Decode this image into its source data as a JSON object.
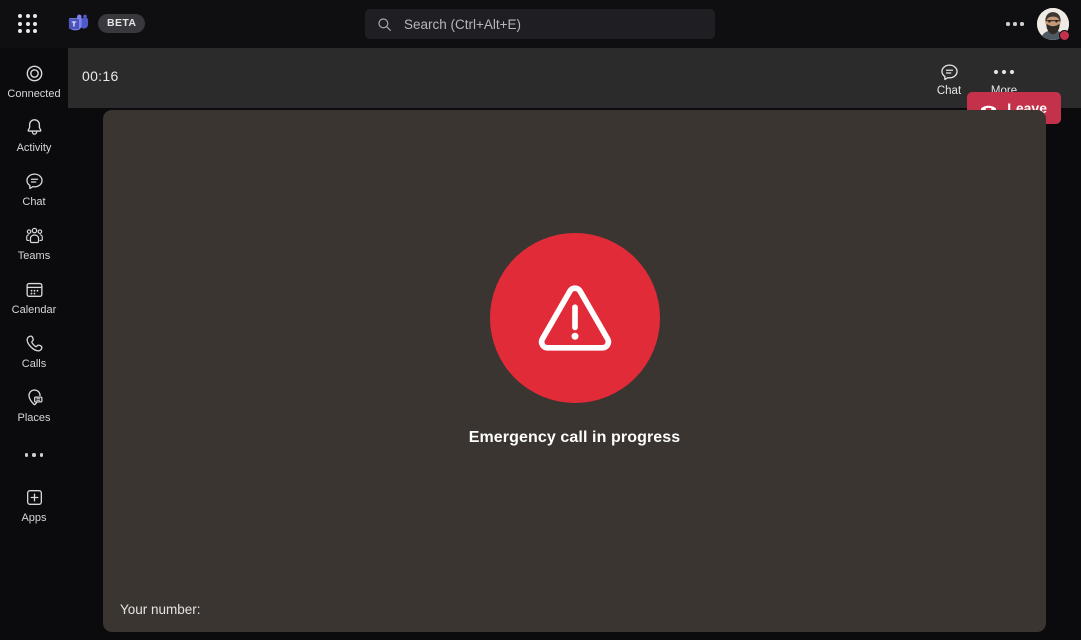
{
  "titlebar": {
    "app_launcher_icon": "waffle-grid-icon",
    "brand_icon": "teams-logo-icon",
    "beta_label": "BETA",
    "search": {
      "icon": "search-icon",
      "placeholder": "Search (Ctrl+Alt+E)",
      "value": ""
    },
    "more_icon": "ellipsis-icon",
    "avatar_icon": "user-avatar",
    "presence_status": "busy",
    "presence_color": "#c4314b"
  },
  "sidebar": {
    "items": [
      {
        "label": "Connected",
        "icon": "connected-ring-icon"
      },
      {
        "label": "Activity",
        "icon": "bell-icon"
      },
      {
        "label": "Chat",
        "icon": "chat-bubble-icon"
      },
      {
        "label": "Teams",
        "icon": "teams-people-icon"
      },
      {
        "label": "Calendar",
        "icon": "calendar-icon"
      },
      {
        "label": "Calls",
        "icon": "phone-icon"
      },
      {
        "label": "Places",
        "icon": "places-pin-icon"
      }
    ],
    "more_icon": "ellipsis-icon",
    "apps": {
      "label": "Apps",
      "icon": "apps-plus-icon"
    }
  },
  "call_toolbar": {
    "timer": "00:16",
    "chat": {
      "label": "Chat",
      "icon": "chat-bubble-icon"
    },
    "more": {
      "label": "More",
      "icon": "ellipsis-icon"
    },
    "leave": {
      "label": "Leave",
      "icon": "hangup-phone-icon",
      "color": "#c4314b"
    }
  },
  "stage": {
    "warning_icon": "warning-triangle-icon",
    "warning_badge_color": "#e22b39",
    "title": "Emergency call in progress",
    "your_number_label": "Your number:",
    "your_number_value": ""
  }
}
